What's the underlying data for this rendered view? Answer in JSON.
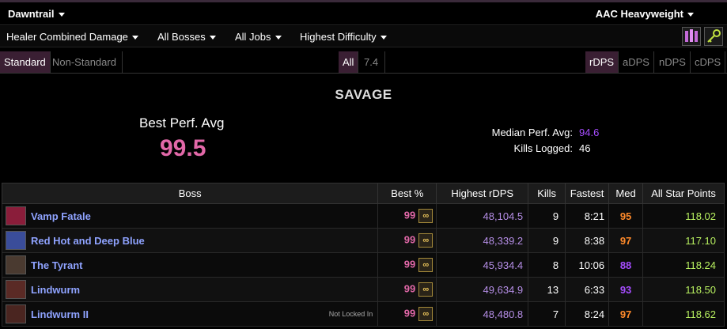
{
  "header": {
    "expansion": "Dawntrail",
    "server": "AAC Heavyweight"
  },
  "filters": [
    {
      "label": "Healer Combined Damage"
    },
    {
      "label": "All Bosses"
    },
    {
      "label": "All Jobs"
    },
    {
      "label": "Highest Difficulty"
    }
  ],
  "modes": {
    "standard": "Standard",
    "non_standard": "Non-Standard",
    "all": "All",
    "patch": "7.4",
    "rdps": "rDPS",
    "adps": "aDPS",
    "ndps": "nDPS",
    "cdps": "cDPS"
  },
  "summary": {
    "difficulty": "SAVAGE",
    "best_perf_label": "Best Perf. Avg",
    "best_perf_value": "99.5",
    "median_label": "Median Perf. Avg:",
    "median_value": "94.6",
    "kills_label": "Kills Logged:",
    "kills_value": "46"
  },
  "table": {
    "headers": [
      "Boss",
      "Best %",
      "Highest rDPS",
      "Kills",
      "Fastest",
      "Med",
      "All Star Points"
    ],
    "rows": [
      {
        "boss": "Vamp Fatale",
        "note": "",
        "best": "99",
        "rdps": "48,104.5",
        "kills": "9",
        "fastest": "8:21",
        "med": "95",
        "med_color": "#ff8a2a",
        "asp": "118.02",
        "icon_color": "#8a1d3a"
      },
      {
        "boss": "Red Hot and Deep Blue",
        "note": "",
        "best": "99",
        "rdps": "48,339.2",
        "kills": "9",
        "fastest": "8:38",
        "med": "97",
        "med_color": "#ff8a2a",
        "asp": "117.10",
        "icon_color": "#3a4d9a"
      },
      {
        "boss": "The Tyrant",
        "note": "",
        "best": "99",
        "rdps": "45,934.4",
        "kills": "8",
        "fastest": "10:06",
        "med": "88",
        "med_color": "#a64dff",
        "asp": "118.24",
        "icon_color": "#4a3a30"
      },
      {
        "boss": "Lindwurm",
        "note": "",
        "best": "99",
        "rdps": "49,634.9",
        "kills": "13",
        "fastest": "6:33",
        "med": "93",
        "med_color": "#a64dff",
        "asp": "118.50",
        "icon_color": "#5a2a25"
      },
      {
        "boss": "Lindwurm II",
        "note": "Not Locked In",
        "best": "99",
        "rdps": "48,480.8",
        "kills": "7",
        "fastest": "8:24",
        "med": "97",
        "med_color": "#ff8a2a",
        "asp": "118.62",
        "icon_color": "#4a2520"
      }
    ]
  }
}
